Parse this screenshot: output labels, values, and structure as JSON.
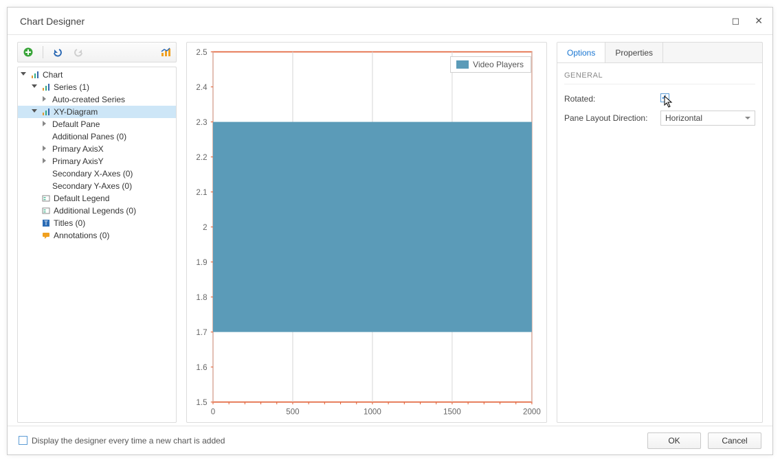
{
  "window": {
    "title": "Chart Designer"
  },
  "tree": {
    "root": "Chart",
    "series": "Series (1)",
    "autoseries": "Auto-created Series",
    "xydiagram": "XY-Diagram",
    "defpane": "Default Pane",
    "addpanes": "Additional Panes (0)",
    "paxisx": "Primary AxisX",
    "paxisy": "Primary AxisY",
    "saxesx": "Secondary X-Axes (0)",
    "saxesy": "Secondary Y-Axes (0)",
    "deflegend": "Default Legend",
    "addlegends": "Additional Legends (0)",
    "titles": "Titles (0)",
    "annotations": "Annotations (0)"
  },
  "legend": {
    "item0": "Video Players"
  },
  "tabs": {
    "options": "Options",
    "properties": "Properties"
  },
  "section": {
    "general": "GENERAL"
  },
  "props": {
    "rotated_label": "Rotated:",
    "layout_label": "Pane Layout Direction:",
    "layout_value": "Horizontal"
  },
  "footer": {
    "checkbox_label": "Display the designer every time a new chart is added",
    "ok": "OK",
    "cancel": "Cancel"
  },
  "chart_data": {
    "type": "bar",
    "orientation": "horizontal",
    "series": [
      {
        "name": "Video Players",
        "y_low": 1.7,
        "y_high": 2.3,
        "x_min": 0,
        "x_max": 2000,
        "color": "#5b9bb8"
      }
    ],
    "x_ticks": [
      0,
      500,
      1000,
      1500,
      2000
    ],
    "y_ticks": [
      1.5,
      1.6,
      1.7,
      1.8,
      1.9,
      2.0,
      2.1,
      2.2,
      2.3,
      2.4,
      2.5
    ],
    "x_range": [
      0,
      2000
    ],
    "y_range": [
      1.5,
      2.5
    ],
    "xlabel": "",
    "ylabel": "",
    "title": ""
  }
}
